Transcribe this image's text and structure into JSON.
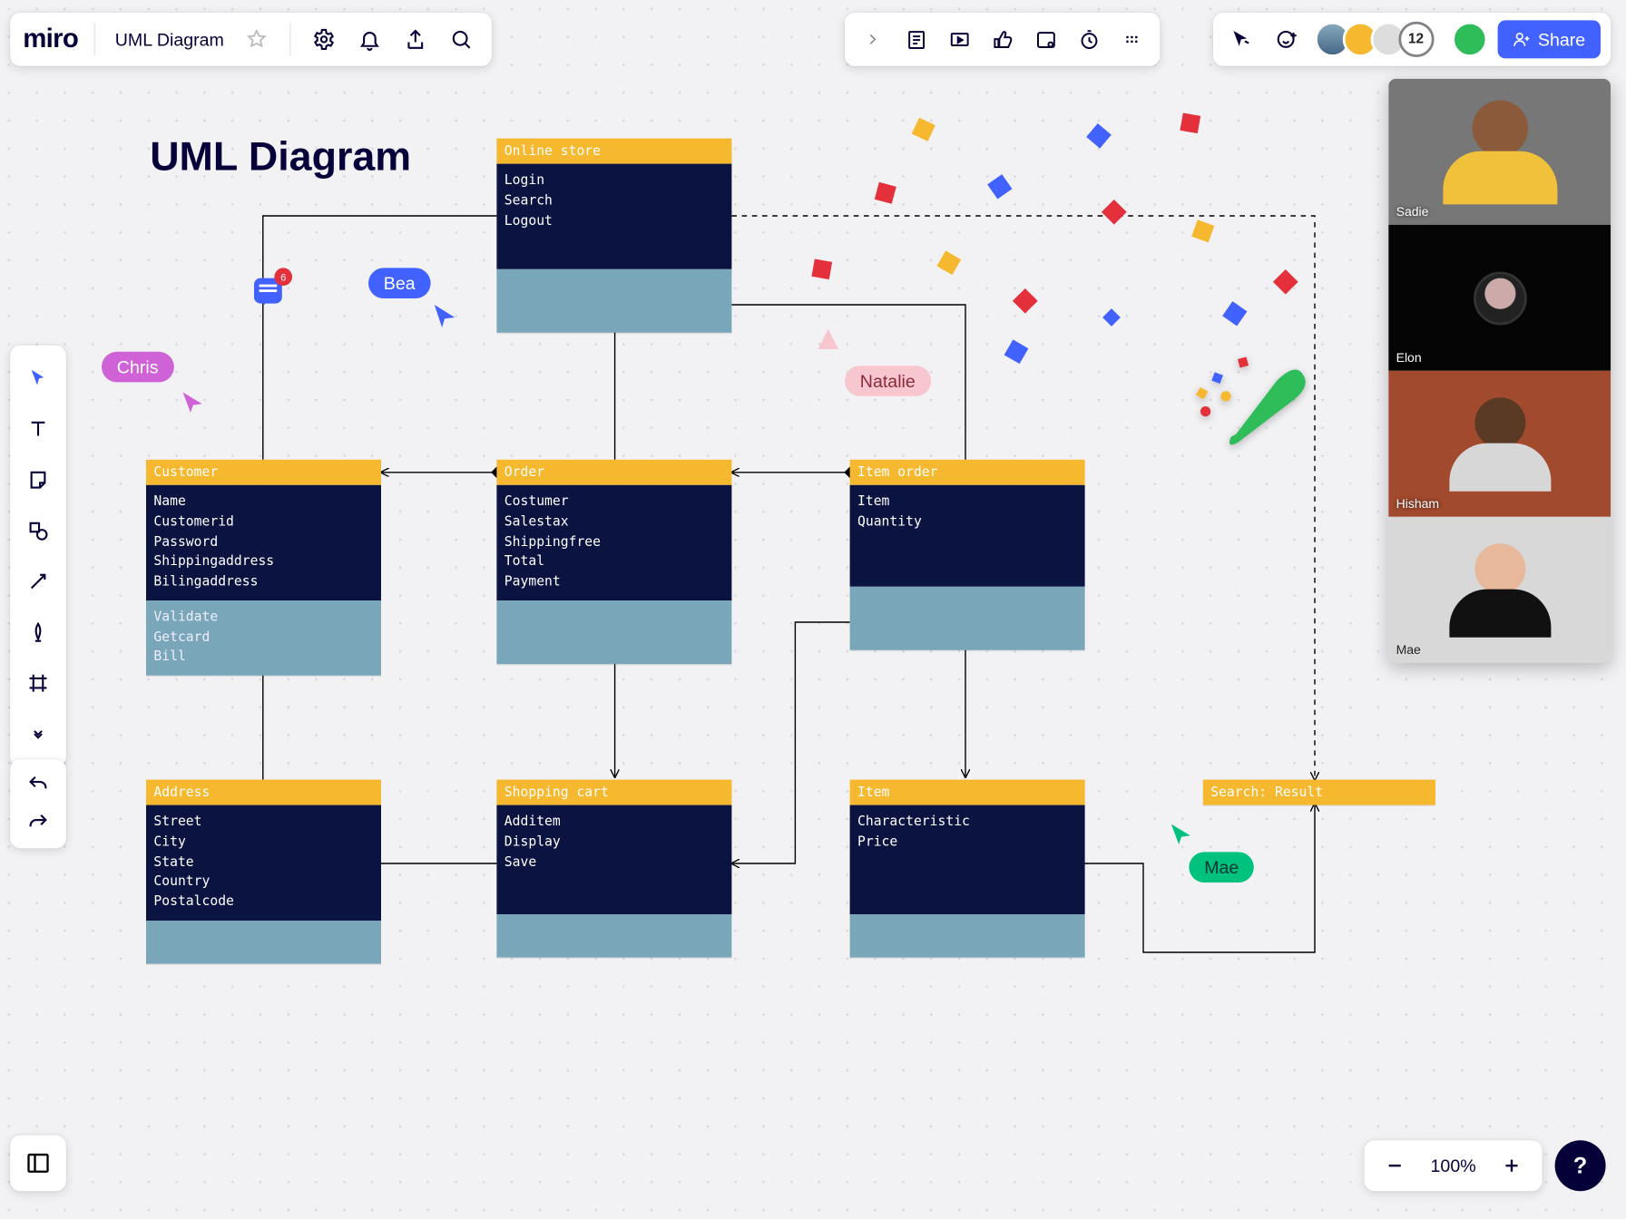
{
  "header": {
    "logo": "miro",
    "board_title": "UML Diagram",
    "share_label": "Share",
    "presence_count": "12"
  },
  "zoom": {
    "level": "100%"
  },
  "help": "?",
  "canvas": {
    "title": "UML Diagram"
  },
  "comment_badge": "6",
  "cursors": {
    "bea": {
      "label": "Bea",
      "color": "#4262FF"
    },
    "chris": {
      "label": "Chris",
      "color": "#CE62D6"
    },
    "nat": {
      "label": "Natalie",
      "color": "#F7C6CE",
      "text": "#333"
    },
    "mae": {
      "label": "Mae",
      "color": "#00C27F"
    }
  },
  "videos": [
    {
      "name": "Sadie",
      "bg": "#6b6b6b",
      "skin": "#8a5a3a",
      "top": "#f2c13b"
    },
    {
      "name": "Elon",
      "bg": "#050505",
      "skin": "#6b4a34",
      "top": "#222",
      "avatar_only": true
    },
    {
      "name": "Hisham",
      "bg": "#b04a2a",
      "skin": "#5a3a24",
      "top": "#d7d7d7"
    },
    {
      "name": "Mae",
      "bg": "#cfcfcf",
      "skin": "#e7b89a",
      "top": "#111"
    }
  ],
  "uml": {
    "online_store": {
      "title": "Online store",
      "attrs": [
        "Login",
        "Search",
        "Logout"
      ],
      "ops": []
    },
    "customer": {
      "title": "Customer",
      "attrs": [
        "Name",
        "Customerid",
        "Password",
        "Shippingaddress",
        "Bilingaddress"
      ],
      "ops": [
        "Validate",
        "Getcard",
        "Bill"
      ]
    },
    "order": {
      "title": "Order",
      "attrs": [
        "Costumer",
        "Salestax",
        "Shippingfree",
        "Total",
        "Payment"
      ],
      "ops": []
    },
    "item_order": {
      "title": "Item order",
      "attrs": [
        "Item",
        "Quantity"
      ],
      "ops": []
    },
    "address": {
      "title": "Address",
      "attrs": [
        "Street",
        "City",
        "State",
        "Country",
        "Postalcode"
      ],
      "ops": []
    },
    "shopping_cart": {
      "title": "Shopping cart",
      "attrs": [
        "Additem",
        "Display",
        "Save"
      ],
      "ops": []
    },
    "item": {
      "title": "Item",
      "attrs": [
        "Characteristic",
        "Price"
      ],
      "ops": []
    },
    "search_result": {
      "title": "Search: Result",
      "attrs": [],
      "ops": []
    }
  }
}
